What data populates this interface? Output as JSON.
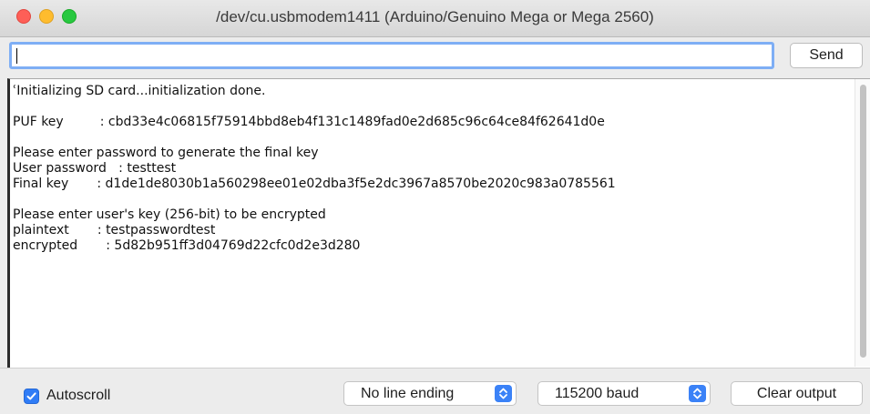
{
  "window": {
    "title": "/dev/cu.usbmodem1411 (Arduino/Genuino Mega or Mega 2560)"
  },
  "input_row": {
    "input_value": "",
    "send_label": "Send"
  },
  "output": {
    "lines": [
      "\u0000Initializing SD card...initialization done.",
      "",
      "PUF key         : cbd33e4c06815f75914bbd8eb4f131c1489fad0e2d685c96c64ce84f62641d0e",
      "",
      "Please enter password to generate the final key",
      "User password   : testtest",
      "Final key       : d1de1de8030b1a560298ee01e02dba3f5e2dc3967a8570be2020c983a0785561",
      "",
      "Please enter user's key (256-bit) to be encrypted",
      "plaintext       : testpasswordtest",
      "encrypted       : 5d82b951ff3d04769d22cfc0d2e3d280"
    ]
  },
  "bottom_bar": {
    "autoscroll_label": "Autoscroll",
    "autoscroll_checked": true,
    "line_ending_value": "No line ending",
    "baud_value": "115200 baud",
    "clear_label": "Clear output"
  },
  "colors": {
    "accent": "#2f7cf6",
    "close": "#fe5f57",
    "minimize": "#febc2e",
    "maximize": "#28c840"
  }
}
